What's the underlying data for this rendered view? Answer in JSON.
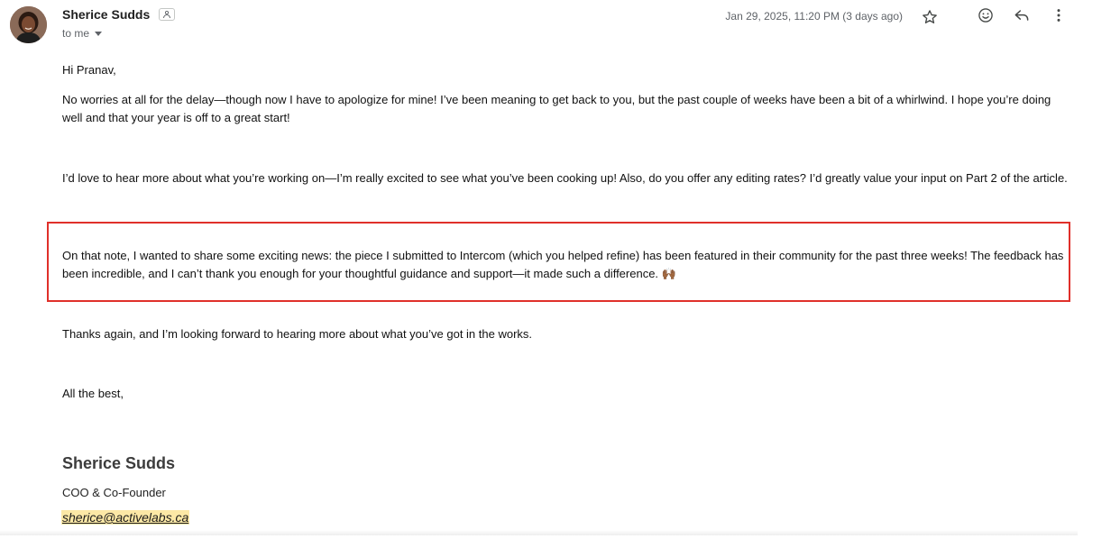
{
  "header": {
    "sender_name": "Sherice Sudds",
    "sender_badge_icon": "person-badge-icon",
    "recipient_label": "to me",
    "timestamp": "Jan 29, 2025, 11:20 PM (3 days ago)",
    "actions": [
      "star-icon",
      "emoji-icon",
      "reply-icon",
      "more-vert-icon"
    ]
  },
  "message": {
    "greeting": "Hi Pranav,",
    "paragraph_1": "No worries at all for the delay—though now I have to apologize for mine! I’ve been meaning to get back to you, but the past couple of weeks have been a bit of a whirlwind. I hope you’re doing well and that your year is off to a great start!",
    "paragraph_2": "I’d love to hear more about what you’re working on—I’m really excited to see what you’ve been cooking up! Also, do you offer any editing rates? I’d greatly value your input on Part 2 of the article.",
    "paragraph_3": "On that note, I wanted to share some exciting news: the piece I submitted to Intercom (which you helped refine) has been featured in their community for the past three weeks! The feedback has been incredible, and I can’t thank you enough for your thoughtful guidance and support—it made such a difference. 🙌🏾",
    "paragraph_4": "Thanks again, and I’m looking forward to hearing more about what you’ve got in the works.",
    "closing": "All the best,"
  },
  "signature": {
    "name": "Sherice Sudds",
    "title": "COO & Co-Founder",
    "email": "sherice@activelabs.ca"
  },
  "colors": {
    "highlight_border": "#e0302a",
    "email_highlight": "#fce8a6",
    "meta_text": "#5f6368"
  }
}
